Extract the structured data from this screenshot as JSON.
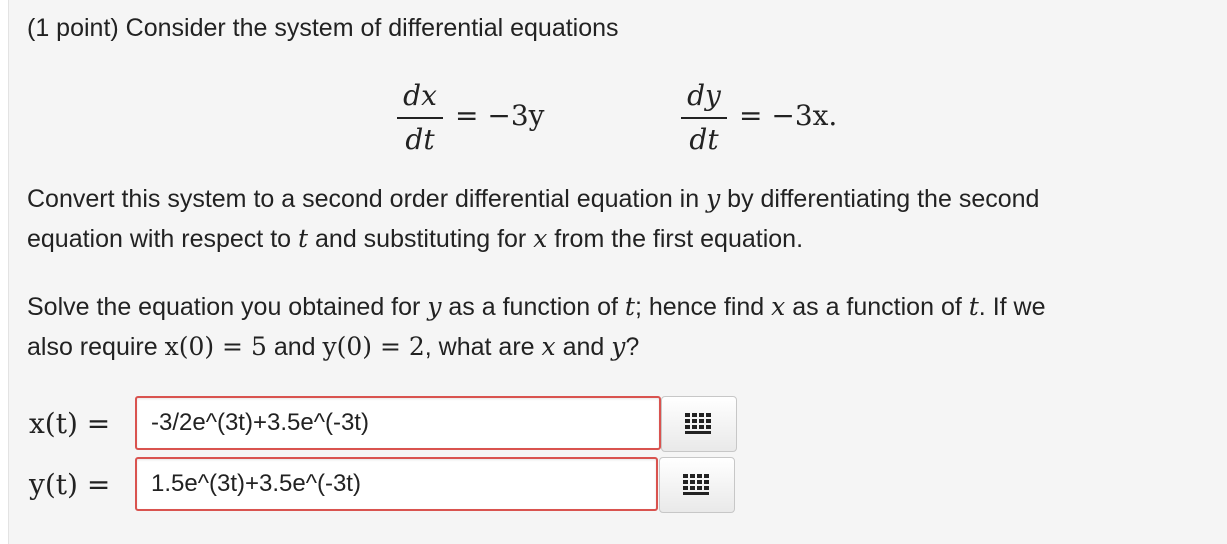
{
  "intro": "(1 point) Consider the system of differential equations",
  "eq1": {
    "num": "dx",
    "den": "dt",
    "rhs": "= −3y"
  },
  "eq2": {
    "num": "dy",
    "den": "dt",
    "rhs": "= −3x."
  },
  "para1": {
    "line1_a": "Convert this system to a second order differential equation in",
    "var_y": "y",
    "line1_b": "by differentiating the second",
    "line2_a": "equation with respect to",
    "var_t": "t",
    "line2_b": "and substituting for",
    "var_x": "x",
    "line2_c": "from the first equation."
  },
  "para2": {
    "line1_a": "Solve the equation you obtained for",
    "var_y": "y",
    "line1_b": "as a function of",
    "var_t": "t",
    "line1_c": "; hence find",
    "var_x": "x",
    "line1_d": "as a function of",
    "var_t2": "t",
    "line1_e": ". If we",
    "line2_a": "also require",
    "cond_x": "x(0) = 5",
    "line2_b": "and",
    "cond_y": "y(0) = 2",
    "line2_c": ", what are",
    "var_x2": "x",
    "line2_d": "and",
    "var_y2": "y",
    "line2_e": "?"
  },
  "answers": [
    {
      "label": "x(t) =",
      "value": "-3/2e^(3t)+3.5e^(-3t)",
      "button_icon": "grid-icon"
    },
    {
      "label": "y(t) =",
      "value": "1.5e^(3t)+3.5e^(-3t)",
      "button_icon": "grid-icon"
    }
  ],
  "colors": {
    "error_border": "#d9534f",
    "panel_bg": "#f5f5f5"
  }
}
